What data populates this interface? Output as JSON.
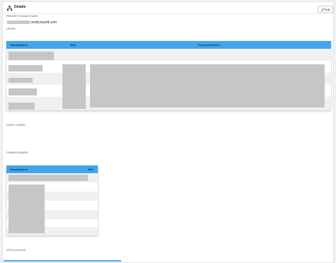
{
  "header": {
    "title": "Details",
    "edit_label": "Edit"
  },
  "primary_domain": {
    "label": "PRIMARY DOMAIN NAME",
    "suffix": ".onmicrosoft.com"
  },
  "users": {
    "label": "USERS",
    "columns": [
      "DisplayName",
      "Mail",
      "ProxyAddresses"
    ]
  },
  "guest_users": {
    "label": "GUEST USERS"
  },
  "domain_admins": {
    "label": "DOMAIN ADMINS",
    "columns": [
      "DisplayName",
      "Mail"
    ]
  },
  "applications": {
    "label": "APPLICATIONS"
  },
  "colors": {
    "header_blue": "#41a6ef",
    "redaction_gray": "#c6c6c6"
  },
  "icons": {
    "header": "sitemap-icon",
    "edit": "pencil-icon"
  }
}
